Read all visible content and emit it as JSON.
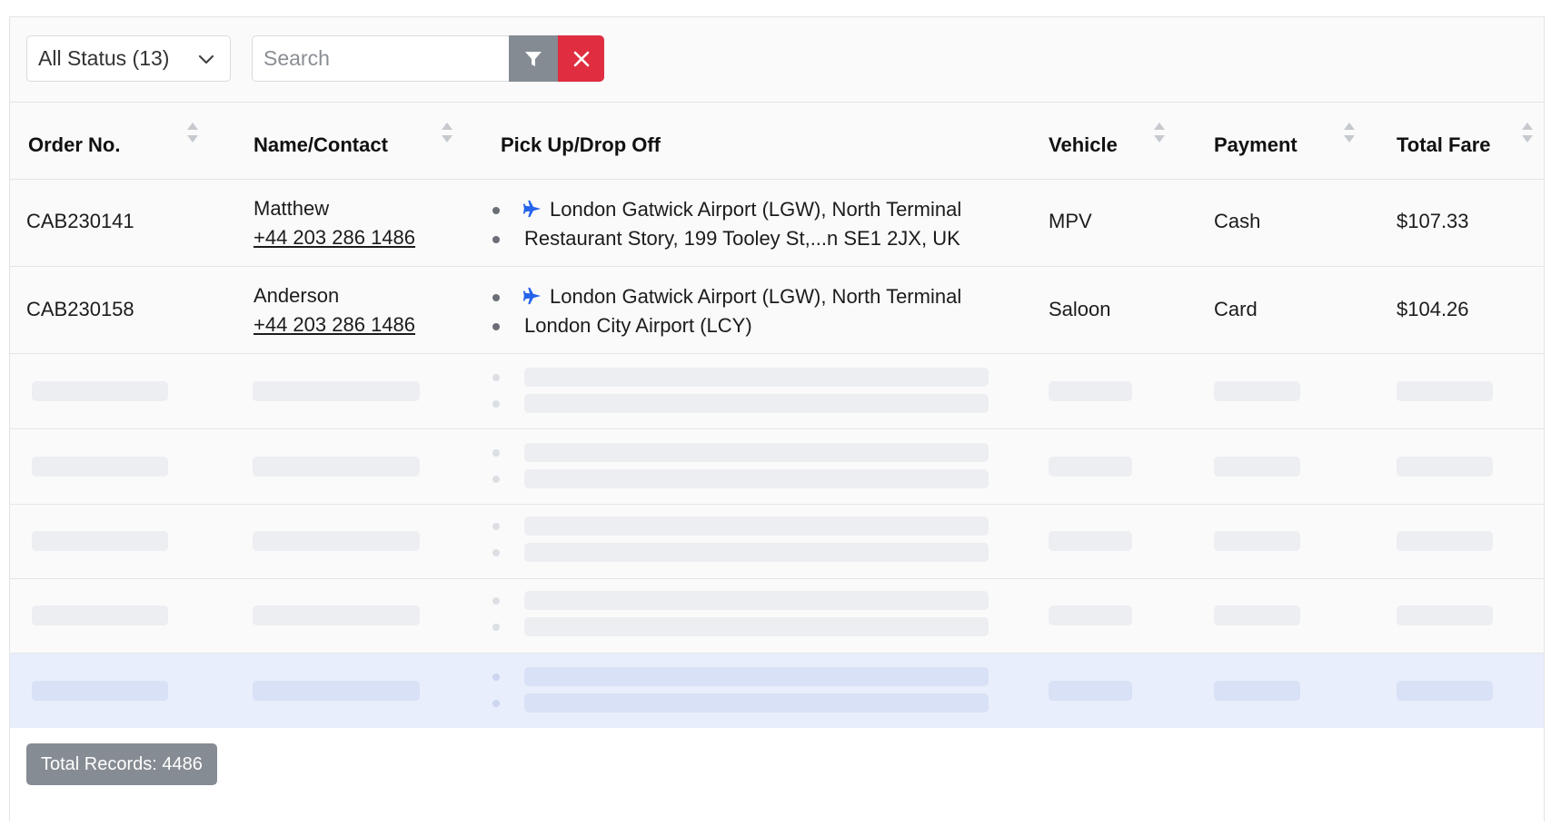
{
  "toolbar": {
    "status_filter": "All Status (13)",
    "search_placeholder": "Search"
  },
  "columns": [
    "Order No.",
    "Name/Contact",
    "Pick Up/Drop Off",
    "Vehicle",
    "Payment",
    "Total Fare"
  ],
  "rows": [
    {
      "order_no": "CAB230141",
      "name": "Matthew",
      "contact": "+44 203 286 1486",
      "pickup": "London Gatwick Airport (LGW), North Terminal",
      "dropoff": "Restaurant Story, 199 Tooley St,...n SE1 2JX, UK",
      "vehicle": "MPV",
      "payment": "Cash",
      "total_fare": "$107.33"
    },
    {
      "order_no": "CAB230158",
      "name": "Anderson",
      "contact": "+44 203 286 1486",
      "pickup": "London Gatwick Airport (LGW), North Terminal",
      "dropoff": "London City Airport (LCY)",
      "vehicle": "Saloon",
      "payment": "Card",
      "total_fare": "$104.26"
    }
  ],
  "footer": {
    "total_records": "Total Records: 4486"
  },
  "colors": {
    "filter_button": "#858b92",
    "clear_button": "#e02d40",
    "airport_icon": "#2563eb",
    "highlight_row": "#e8eefb"
  }
}
